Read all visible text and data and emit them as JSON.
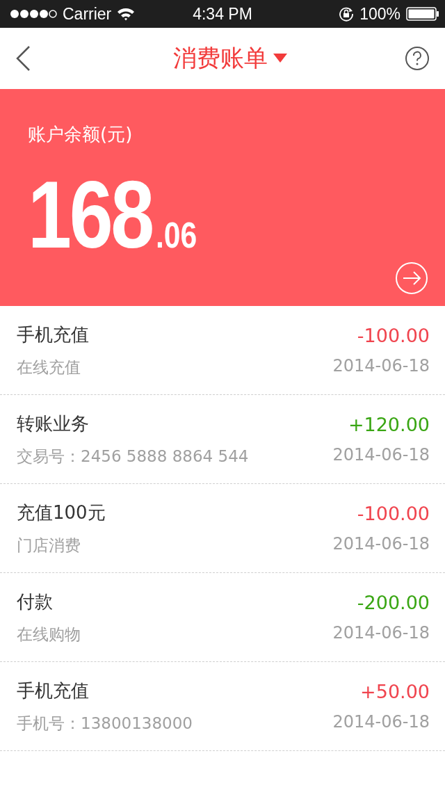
{
  "status_bar": {
    "carrier": "Carrier",
    "time": "4:34 PM",
    "battery": "100%"
  },
  "header": {
    "title": "消费账单"
  },
  "balance": {
    "label": "账户余额(元)",
    "integer": "168",
    "decimal": ".06"
  },
  "transactions": [
    {
      "title": "手机充值",
      "detail": "在线充值",
      "amount": "-100.00",
      "date": "2014-06-18",
      "color": "#f0444e"
    },
    {
      "title": "转账业务",
      "detail": "交易号：2456 5888 8864 544",
      "amount": "+120.00",
      "date": "2014-06-18",
      "color": "#3aa614"
    },
    {
      "title": "充值100元",
      "detail": "门店消费",
      "amount": "-100.00",
      "date": "2014-06-18",
      "color": "#f0444e"
    },
    {
      "title": "付款",
      "detail": "在线购物",
      "amount": "-200.00",
      "date": "2014-06-18",
      "color": "#3aa614"
    },
    {
      "title": "手机充值",
      "detail": "手机号：13800138000",
      "amount": "+50.00",
      "date": "2014-06-18",
      "color": "#f0444e"
    }
  ]
}
